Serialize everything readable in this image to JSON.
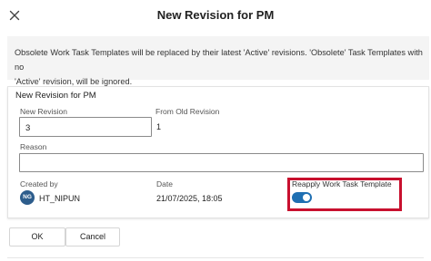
{
  "dialog": {
    "title": "New Revision for PM",
    "info_line1": "Obsolete Work Task Templates will be replaced by their latest 'Active' revisions. 'Obsolete' Task Templates with no",
    "info_line2": "'Active' revision, will be ignored."
  },
  "panel": {
    "title": "New Revision for PM",
    "new_revision_label": "New Revision",
    "new_revision_value": "3",
    "from_old_revision_label": "From Old Revision",
    "from_old_revision_value": "1",
    "reason_label": "Reason",
    "reason_value": "",
    "created_by_label": "Created by",
    "created_by_initials": "NG",
    "created_by_name": "HT_NIPUN",
    "date_label": "Date",
    "date_value": "21/07/2025, 18:05",
    "reapply_label": "Reapply Work Task Template",
    "reapply_on": true
  },
  "footer": {
    "ok_label": "OK",
    "cancel_label": "Cancel"
  },
  "colors": {
    "accent": "#1f6fb2",
    "avatar": "#2d5d8c",
    "highlight": "#c8102e"
  },
  "icons": {
    "close": "close-icon"
  }
}
